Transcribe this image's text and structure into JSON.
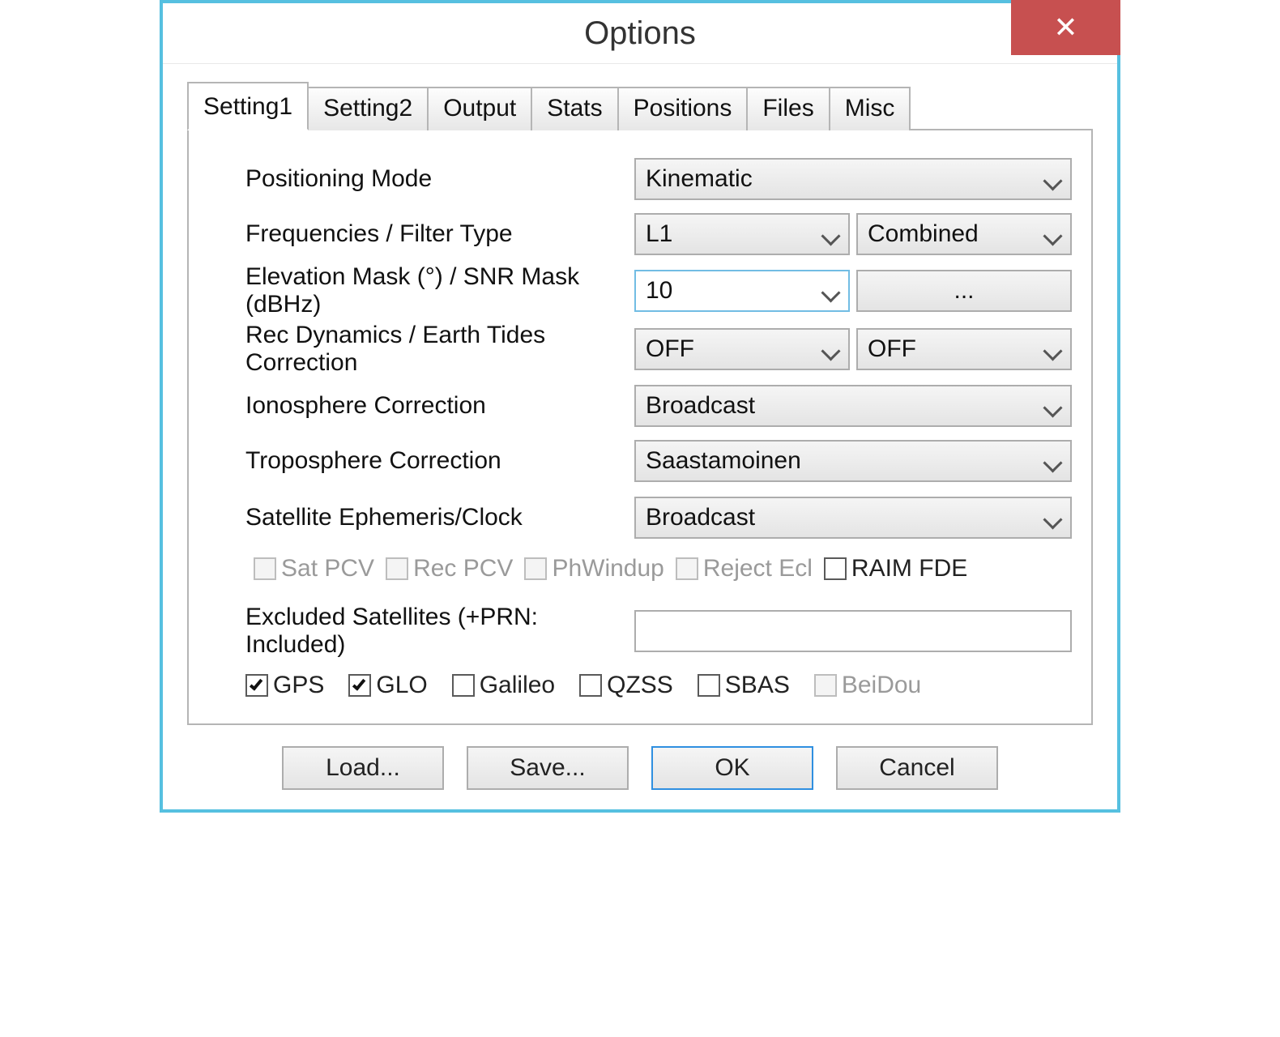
{
  "window": {
    "title": "Options"
  },
  "tabs": {
    "items": [
      {
        "label": "Setting1"
      },
      {
        "label": "Setting2"
      },
      {
        "label": "Output"
      },
      {
        "label": "Stats"
      },
      {
        "label": "Positions"
      },
      {
        "label": "Files"
      },
      {
        "label": "Misc"
      }
    ],
    "active_index": 0
  },
  "setting1": {
    "positioning_mode": {
      "label": "Positioning Mode",
      "value": "Kinematic"
    },
    "freq_filter": {
      "label": "Frequencies / Filter Type",
      "freq": "L1",
      "filter": "Combined"
    },
    "elev_snr": {
      "label": "Elevation Mask (°) / SNR Mask (dBHz)",
      "elev": "10",
      "snr_btn": "..."
    },
    "dyn_tides": {
      "label": "Rec Dynamics / Earth Tides Correction",
      "dyn": "OFF",
      "tides": "OFF"
    },
    "iono": {
      "label": "Ionosphere Correction",
      "value": "Broadcast"
    },
    "tropo": {
      "label": "Troposphere Correction",
      "value": "Saastamoinen"
    },
    "ephem": {
      "label": "Satellite Ephemeris/Clock",
      "value": "Broadcast"
    },
    "corr_checks": {
      "sat_pcv": {
        "label": "Sat PCV",
        "checked": false,
        "disabled": true
      },
      "rec_pcv": {
        "label": "Rec PCV",
        "checked": false,
        "disabled": true
      },
      "phwindup": {
        "label": "PhWindup",
        "checked": false,
        "disabled": true
      },
      "reject_ecl": {
        "label": "Reject Ecl",
        "checked": false,
        "disabled": true
      },
      "raim_fde": {
        "label": "RAIM FDE",
        "checked": false,
        "disabled": false
      }
    },
    "excluded": {
      "label": "Excluded Satellites (+PRN: Included)",
      "value": ""
    },
    "systems": {
      "gps": {
        "label": "GPS",
        "checked": true,
        "disabled": false
      },
      "glo": {
        "label": "GLO",
        "checked": true,
        "disabled": false
      },
      "galileo": {
        "label": "Galileo",
        "checked": false,
        "disabled": false
      },
      "qzss": {
        "label": "QZSS",
        "checked": false,
        "disabled": false
      },
      "sbas": {
        "label": "SBAS",
        "checked": false,
        "disabled": false
      },
      "beidou": {
        "label": "BeiDou",
        "checked": false,
        "disabled": true
      }
    }
  },
  "buttons": {
    "load": "Load...",
    "save": "Save...",
    "ok": "OK",
    "cancel": "Cancel"
  }
}
